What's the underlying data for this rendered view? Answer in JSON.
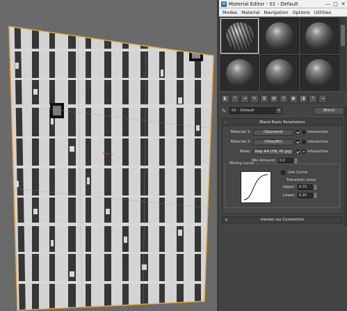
{
  "window": {
    "title": "Material Editor - 01 - Default",
    "controls": [
      "—",
      "□",
      "✕"
    ]
  },
  "menu": {
    "items": [
      "Modes",
      "Material",
      "Navigation",
      "Options",
      "Utilities"
    ]
  },
  "material": {
    "name": "01 - Default",
    "type_button": "Blend"
  },
  "blend": {
    "rollout_title": "Blend Basic Parameters",
    "material1_label": "Material 1:",
    "material1_value": "(Standard)",
    "material2_label": "Material 2:",
    "material2_value": "(VRayMtl)",
    "mask_label": "Mask:",
    "mask_value": "Map #4 (HB_45.jpg)",
    "interactive_label": "Interactive",
    "mix_amount_label": "Mix Amount:",
    "mix_amount_value": "0.0",
    "mixing_curve_label": "Mixing curve",
    "use_curve_label": "Use Curve",
    "transition_zone_label": "Transition zone:",
    "upper_label": "Upper:",
    "upper_value": "0.75",
    "lower_label": "Lower:",
    "lower_value": "0.25"
  },
  "mental_ray": {
    "rollout_title": "mental ray Connection"
  },
  "rollout_signs": {
    "expanded": "-",
    "collapsed": "+"
  },
  "icons": {
    "titlebar": "material-editor-app-icon",
    "toolbar": [
      "get-material-icon",
      "put-to-scene-icon",
      "assign-material-icon",
      "reset-map-icon",
      "make-unique-icon",
      "put-to-library-icon",
      "material-id-icon",
      "show-map-icon",
      "show-end-result-icon",
      "go-to-parent-icon",
      "go-forward-icon"
    ]
  },
  "colors": {
    "accent": "#2a6fb0",
    "panel": "#444444",
    "viewport": "#6a6a6a",
    "plane_border": "#e8a640"
  }
}
